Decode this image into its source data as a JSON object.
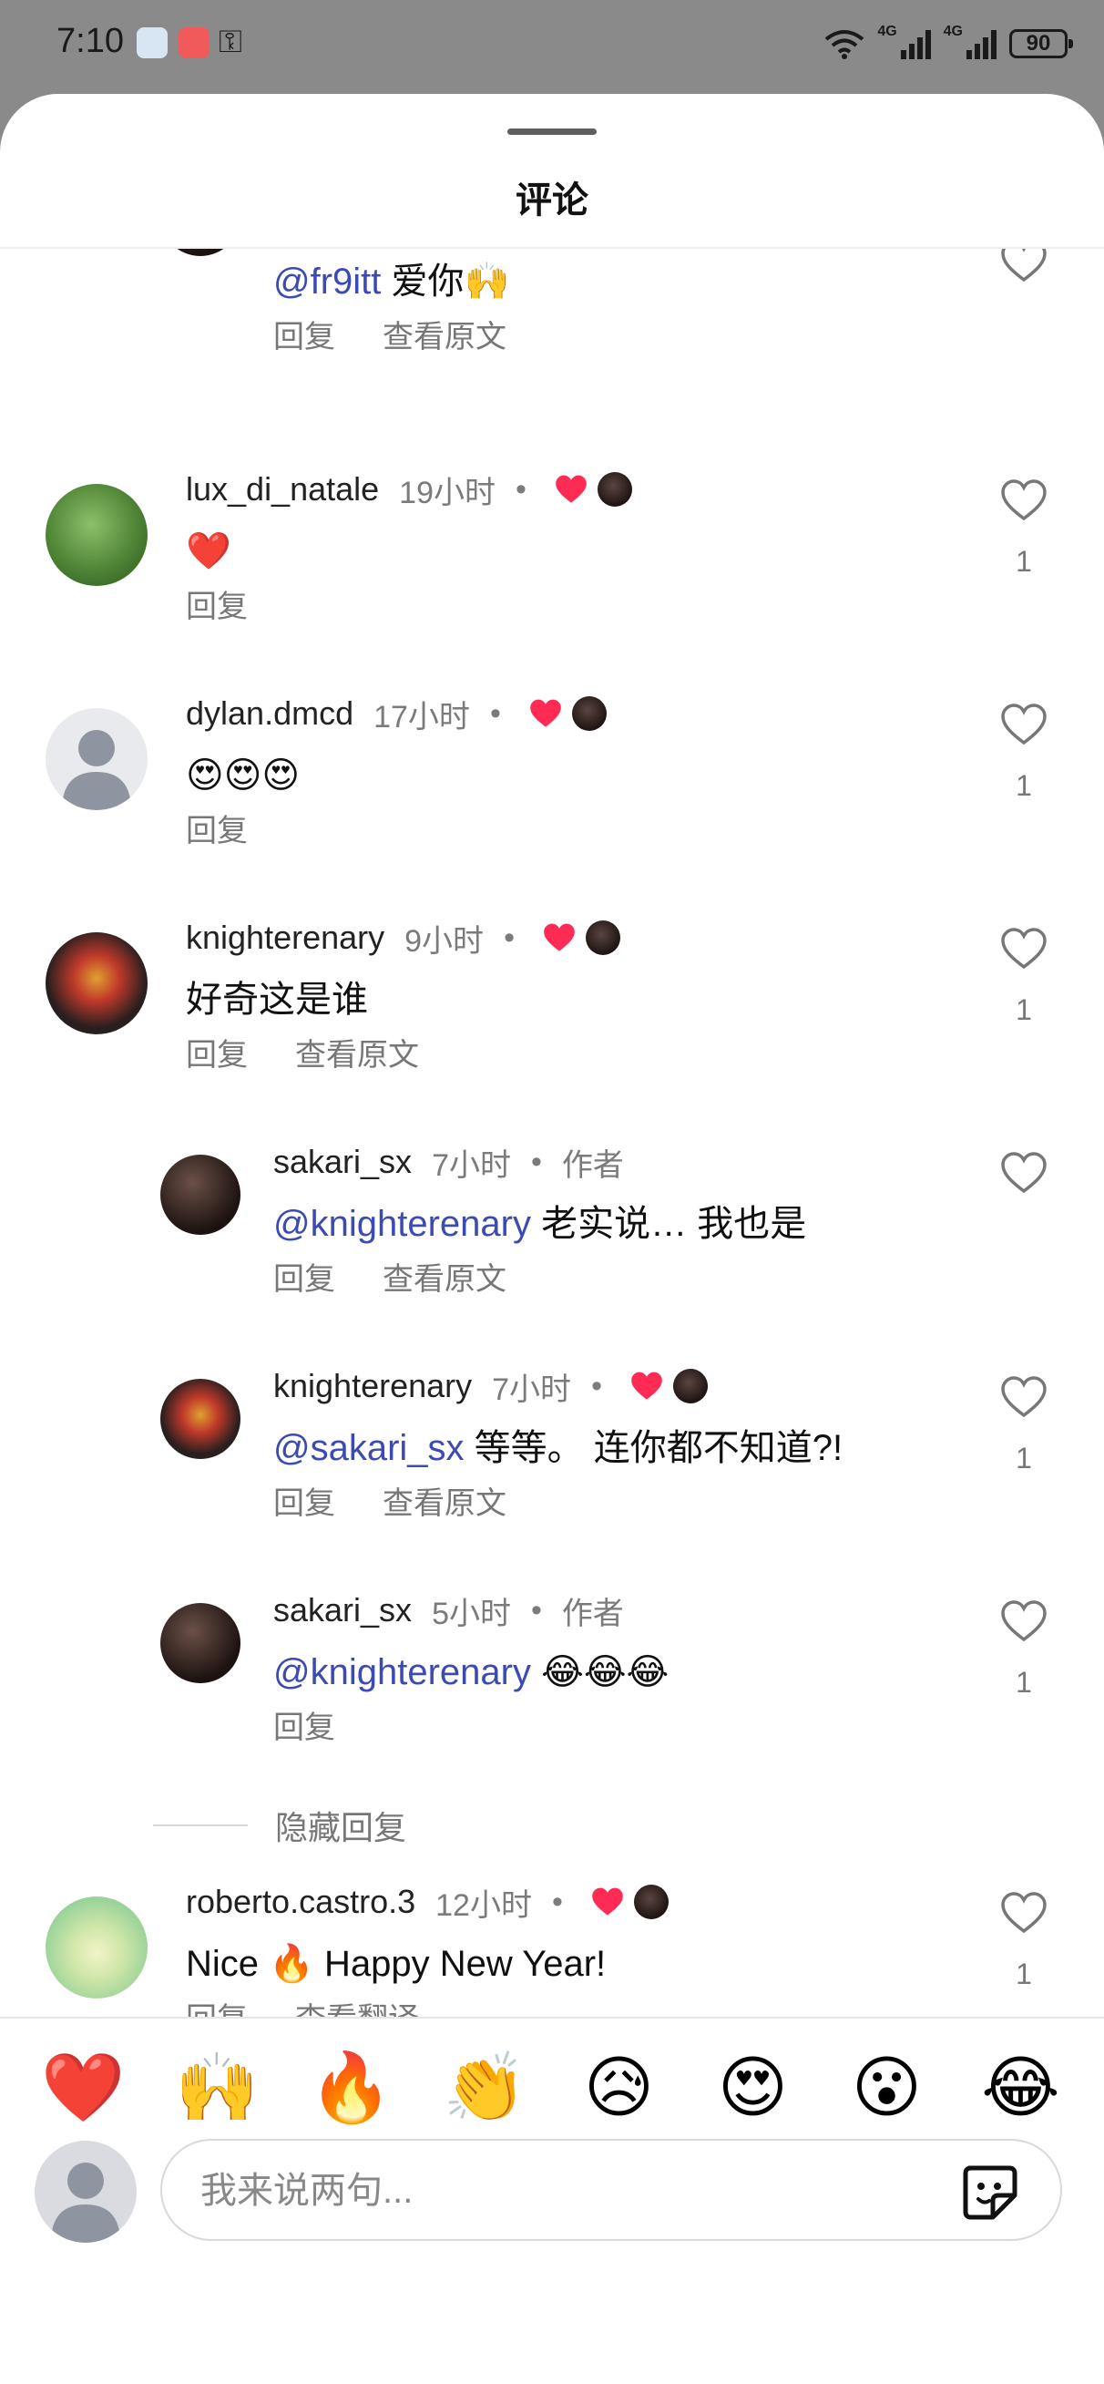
{
  "status_bar": {
    "time": "7:10",
    "battery": "90",
    "network_1": "4G",
    "network_2": "4G"
  },
  "sheet": {
    "title": "评论"
  },
  "top_partial": {
    "mention": "@fr9itt",
    "text": " 爱你🙌",
    "actions": [
      "回复",
      "查看原文"
    ]
  },
  "comments": [
    {
      "username": "lux_di_natale",
      "time": "19小时",
      "dot": "•",
      "text": "❤️",
      "actions": [
        "回复"
      ],
      "likes": "1"
    },
    {
      "username": "dylan.dmcd",
      "time": "17小时",
      "dot": "•",
      "text": "😍😍😍",
      "actions": [
        "回复"
      ],
      "likes": "1"
    },
    {
      "username": "knighterenary",
      "time": "9小时",
      "dot": "•",
      "text": "好奇这是谁",
      "actions": [
        "回复",
        "查看原文"
      ],
      "likes": "1"
    }
  ],
  "replies": [
    {
      "username": "sakari_sx",
      "time": "7小时",
      "dot": "•",
      "author": "作者",
      "mention": "@knighterenary",
      "text": " 老实说… 我也是",
      "actions": [
        "回复",
        "查看原文"
      ],
      "likes": ""
    },
    {
      "username": "knighterenary",
      "time": "7小时",
      "dot": "•",
      "mention": "@sakari_sx",
      "text": " 等等。 连你都不知道?!",
      "actions": [
        "回复",
        "查看原文"
      ],
      "likes": "1"
    },
    {
      "username": "sakari_sx",
      "time": "5小时",
      "dot": "•",
      "author": "作者",
      "mention": "@knighterenary",
      "text": " 😂😂😂",
      "actions": [
        "回复"
      ],
      "likes": "1"
    }
  ],
  "hide_replies": "隐藏回复",
  "last_comment": {
    "username": "roberto.castro.3",
    "time": "12小时",
    "dot": "•",
    "text": "Nice 🔥 Happy New Year!",
    "actions": [
      "回复",
      "查看翻译"
    ],
    "likes": "1"
  },
  "emoji_bar": [
    "❤️",
    "🙌",
    "🔥",
    "👏",
    "😥",
    "😍",
    "😮",
    "😂"
  ],
  "composer": {
    "placeholder": "我来说两句..."
  },
  "colors": {
    "like_red": "#fe2c55",
    "mention_blue": "#3b4bb3"
  }
}
